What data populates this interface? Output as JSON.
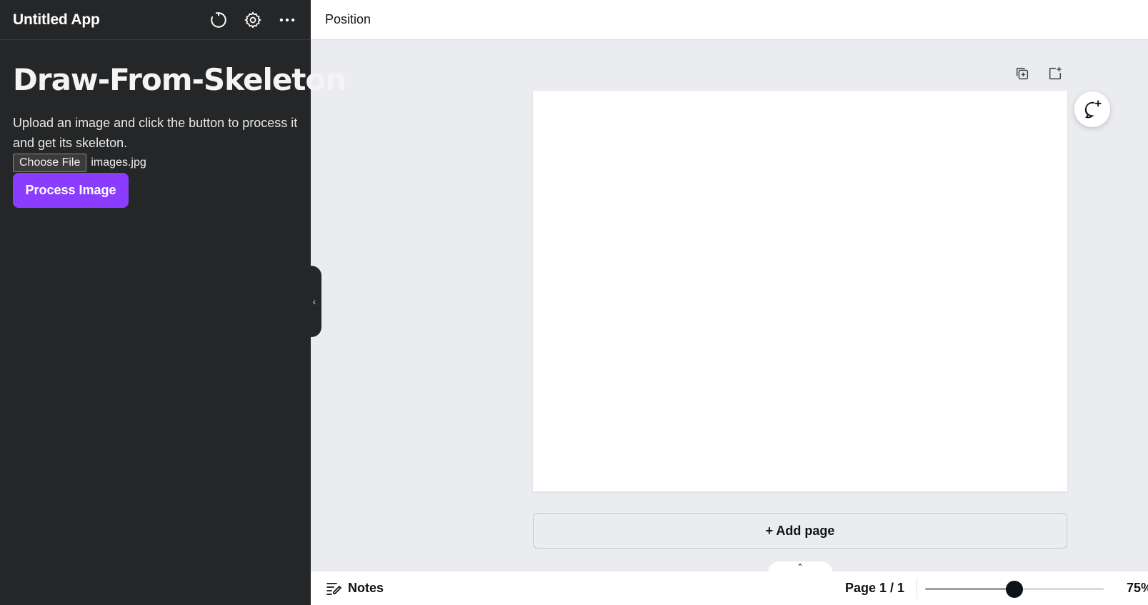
{
  "sidebar": {
    "app_title": "Untitled App",
    "icons": {
      "refresh": "refresh-icon",
      "settings": "gear-icon",
      "more": "more-horizontal-icon"
    },
    "heading": "Draw-From-Skeleton",
    "description": "Upload an image and click the button to process it and get its skeleton.",
    "file_input": {
      "button_label": "Choose File",
      "file_name": "images.jpg"
    },
    "process_button_label": "Process Image",
    "collapse_glyph": "‹"
  },
  "topbar": {
    "position_label": "Position"
  },
  "canvas": {
    "page_tools": [
      "duplicate-page-icon",
      "add-page-icon"
    ],
    "comment_icon": "add-comment-icon",
    "add_page_label": "+ Add page"
  },
  "bottombar": {
    "expand_glyph": "⌃",
    "notes_label": "Notes",
    "page_indicator": "Page 1 / 1",
    "zoom_percent": 75,
    "zoom_label": "75%",
    "zoom_slider_fraction": 0.5
  },
  "colors": {
    "sidebar_bg": "#252627",
    "accent": "#8b3dff",
    "workspace_bg": "#ebecf0",
    "text_dark": "#0e1318"
  }
}
